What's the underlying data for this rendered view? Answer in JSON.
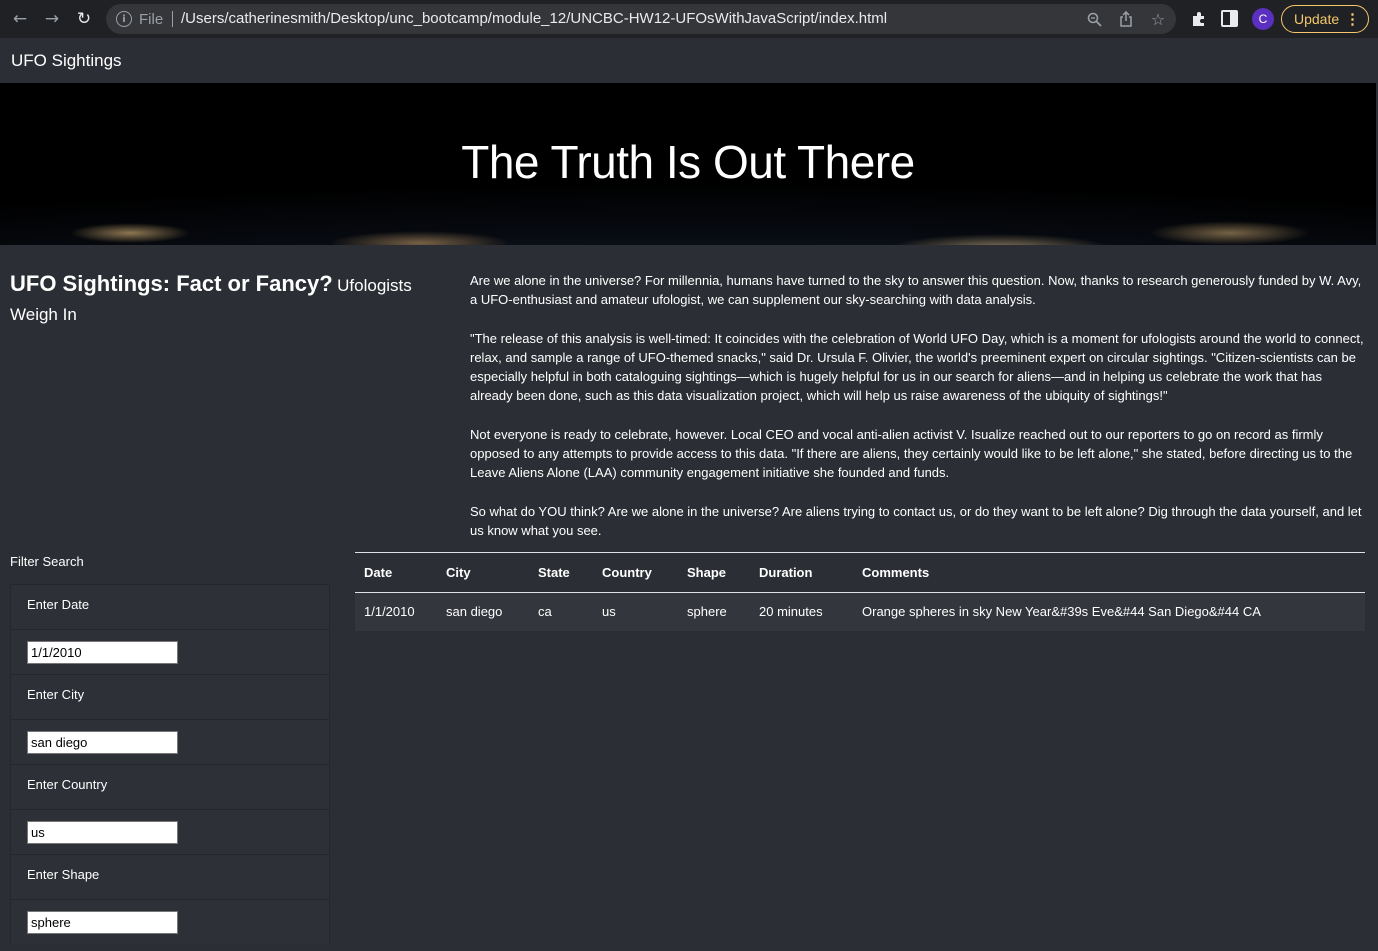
{
  "browser": {
    "file_label": "File",
    "url": "/Users/catherinesmith/Desktop/unc_bootcamp/module_12/UNCBC-HW12-UFOsWithJavaScript/index.html",
    "avatar_letter": "C",
    "update_label": "Update",
    "colors": {
      "chrome_bg": "#202124",
      "omnibox_bg": "#35363a",
      "update_accent": "#f5c66a",
      "avatar_bg": "#5b2fbf"
    }
  },
  "navbar": {
    "brand": "UFO Sightings"
  },
  "hero": {
    "title": "The Truth Is Out There"
  },
  "article": {
    "heading_main": "UFO Sightings: Fact or Fancy?",
    "heading_sub": "Ufologists Weigh In",
    "paragraphs": [
      "Are we alone in the universe? For millennia, humans have turned to the sky to answer this question. Now, thanks to research generously funded by W. Avy, a UFO-enthusiast and amateur ufologist, we can supplement our sky-searching with data analysis.",
      "\"The release of this analysis is well-timed: It coincides with the celebration of World UFO Day, which is a moment for ufologists around the world to connect, relax, and sample a range of UFO-themed snacks,\" said Dr. Ursula F. Olivier, the world's preeminent expert on circular sightings. \"Citizen-scientists can be especially helpful in both cataloguing sightings—which is hugely helpful for us in our search for aliens—and in helping us celebrate the work that has already been done, such as this data visualization project, which will help us raise awareness of the ubiquity of sightings!\"",
      "Not everyone is ready to celebrate, however. Local CEO and vocal anti-alien activist V. Isualize reached out to our reporters to go on record as firmly opposed to any attempts to provide access to this data. \"If there are aliens, they certainly would like to be left alone,\" she stated, before directing us to the Leave Aliens Alone (LAA) community engagement initiative she founded and funds.",
      "So what do YOU think? Are we alone in the universe? Are aliens trying to contact us, or do they want to be left alone? Dig through the data yourself, and let us know what you see."
    ]
  },
  "filters": {
    "title": "Filter Search",
    "items": [
      {
        "label": "Enter Date",
        "value": "1/1/2010"
      },
      {
        "label": "Enter City",
        "value": "san diego"
      },
      {
        "label": "Enter Country",
        "value": "us"
      },
      {
        "label": "Enter Shape",
        "value": "sphere"
      }
    ]
  },
  "table": {
    "headers": [
      "Date",
      "City",
      "State",
      "Country",
      "Shape",
      "Duration",
      "Comments"
    ],
    "rows": [
      [
        "1/1/2010",
        "san diego",
        "ca",
        "us",
        "sphere",
        "20 minutes",
        "Orange spheres in sky New Year&#39s Eve&#44 San Diego&#44 CA"
      ]
    ]
  }
}
